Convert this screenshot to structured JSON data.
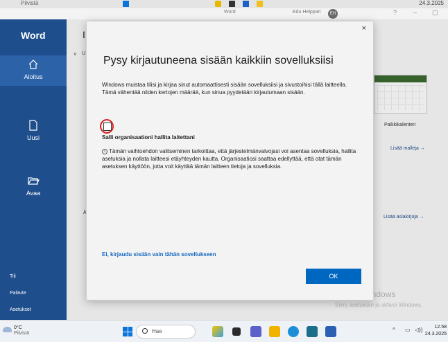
{
  "top_strip": {
    "left_text": "Pilvistä",
    "right_text": "24.3.2025"
  },
  "titlebar": {
    "doc_label": "Word",
    "user_name": "Edu Helppari",
    "avatar_initials": "EH",
    "help": "?",
    "minimize": "–",
    "restore": "▢"
  },
  "leftnav": {
    "app_name": "Word",
    "items": [
      {
        "label": "Aloitus",
        "icon": "home-icon"
      },
      {
        "label": "Uusi",
        "icon": "new-document-icon"
      },
      {
        "label": "Avaa",
        "icon": "folder-open-icon"
      }
    ],
    "bottom_items": [
      "Tili",
      "Palaute",
      "Asetukset"
    ]
  },
  "main": {
    "greeting_initial": "I",
    "template_label": "Palkkikalenteri",
    "more_templates": "Lisää malleja",
    "more_documents": "Lisää asiakirjoja",
    "template_header": "ikuu",
    "collapse_chevron": "˅",
    "partial_u": "U",
    "partial_a": "Ä"
  },
  "dialog": {
    "title": "Pysy kirjautuneena sisään kaikkiin sovelluksiisi",
    "description": "Windows muistaa tilisi ja kirjaa sinut automaattisesti sisään sovelluksiisi ja sivustoihisi tällä laitteella. Tämä vähentää niiden kertojen määrää, kun sinua pyydetään kirjautumaan sisään.",
    "checkbox_label": "Salli organisaationi hallita laitettani",
    "info_text": "Tämän vaihtoehdon valitseminen tarkoittaa, että järjestelmänvalvojasi voi asentaa sovelluksia, hallita asetuksia ja nollata laitteesi etäyhteyden kautta. Organisaatiosi saattaa edellyttää, että otat tämän asetuksen käyttöön, jotta voit käyttää tämän laitteen tietoja ja sovelluksia.",
    "no_signin_link": "Ei, kirjaudu sisään vain tähän sovellukseen",
    "ok_label": "OK",
    "close_label": "×"
  },
  "watermark": {
    "line1": "Aktivoi Windows",
    "line2": "Siirry asetuksiin ja aktivoi Windows."
  },
  "taskbar": {
    "weather_temp": "0°C",
    "weather_desc": "Pilvistä",
    "search_placeholder": "Hae",
    "time": "12.58",
    "date": "24.3.2025",
    "tray_chevron": "^"
  },
  "colors": {
    "nav_blue": "#1e4e8c",
    "ok_blue": "#0067c0",
    "link_blue": "#1366c0",
    "highlight_red": "#d42020"
  }
}
